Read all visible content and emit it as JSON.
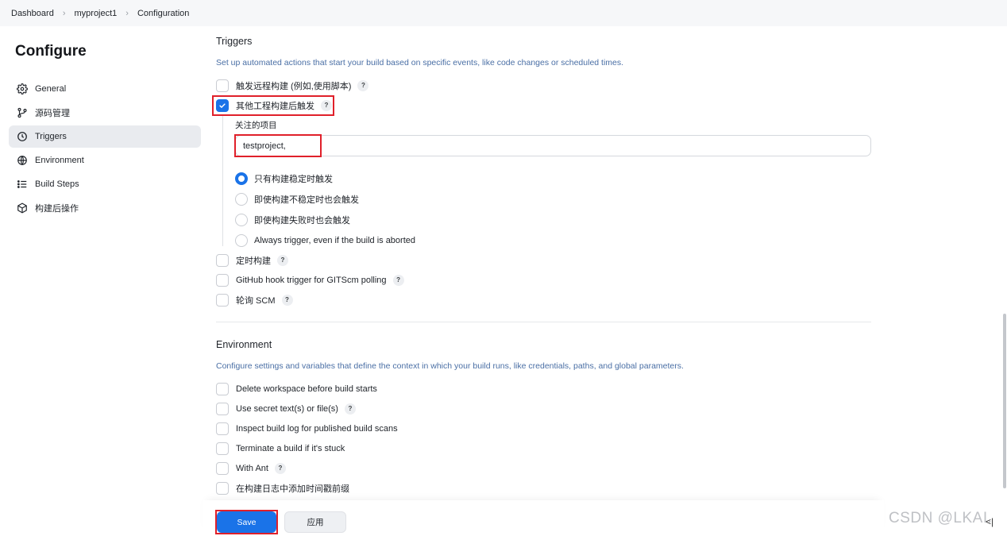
{
  "breadcrumb": [
    "Dashboard",
    "myproject1",
    "Configuration"
  ],
  "sidebar": {
    "title": "Configure",
    "items": [
      {
        "label": "General",
        "icon": "gear-icon",
        "active": false
      },
      {
        "label": "源码管理",
        "icon": "branch-icon",
        "active": false
      },
      {
        "label": "Triggers",
        "icon": "clock-icon",
        "active": true
      },
      {
        "label": "Environment",
        "icon": "globe-icon",
        "active": false
      },
      {
        "label": "Build Steps",
        "icon": "list-icon",
        "active": false
      },
      {
        "label": "构建后操作",
        "icon": "cube-icon",
        "active": false
      }
    ]
  },
  "triggers": {
    "title": "Triggers",
    "description": "Set up automated actions that start your build based on specific events, like code changes or scheduled times.",
    "options": [
      {
        "label": "触发远程构建 (例如,使用脚本)",
        "checked": false,
        "help": "?"
      },
      {
        "label": "其他工程构建后触发",
        "checked": true,
        "help": "?"
      },
      {
        "label": "定时构建",
        "checked": false,
        "help": "?"
      },
      {
        "label": "GitHub hook trigger for GITScm polling",
        "checked": false,
        "help": "?"
      },
      {
        "label": "轮询 SCM",
        "checked": false,
        "help": "?"
      }
    ],
    "watched_projects": {
      "label": "关注的项目",
      "value": "testproject,"
    },
    "radios": [
      {
        "label": "只有构建稳定时触发",
        "selected": true
      },
      {
        "label": "即使构建不稳定时也会触发",
        "selected": false
      },
      {
        "label": "即使构建失败时也会触发",
        "selected": false
      },
      {
        "label": "Always trigger, even if the build is aborted",
        "selected": false
      }
    ]
  },
  "environment": {
    "title": "Environment",
    "description": "Configure settings and variables that define the context in which your build runs, like credentials, paths, and global parameters.",
    "options": [
      {
        "label": "Delete workspace before build starts",
        "checked": false,
        "help": ""
      },
      {
        "label": "Use secret text(s) or file(s)",
        "checked": false,
        "help": "?"
      },
      {
        "label": "Inspect build log for published build scans",
        "checked": false,
        "help": ""
      },
      {
        "label": "Terminate a build if it's stuck",
        "checked": false,
        "help": ""
      },
      {
        "label": "With Ant",
        "checked": false,
        "help": "?"
      },
      {
        "label": "在构建日志中添加时间戳前缀",
        "checked": false,
        "help": ""
      }
    ]
  },
  "buttons": {
    "save": "Save",
    "apply": "应用"
  },
  "watermark": "CSDN @LKAI.",
  "collapse_glyph": "<|",
  "colors": {
    "accent": "#1a73e8",
    "annotation": "#e0202a",
    "description": "#4a6fa5"
  }
}
